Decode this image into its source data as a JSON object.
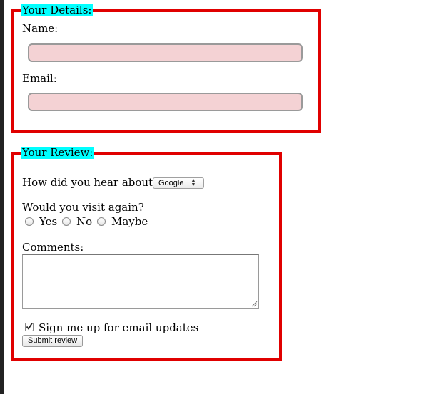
{
  "details": {
    "legend": "Your Details:",
    "name_label": "Name:",
    "name_value": "",
    "email_label": "Email:",
    "email_value": ""
  },
  "review": {
    "legend": "Your Review:",
    "heard_label": "How did you hear about us?",
    "heard_selected": "Google",
    "visit_label": "Would you visit again?",
    "visit_options": [
      "Yes",
      "No",
      "Maybe"
    ],
    "comments_label": "Comments:",
    "comments_value": "",
    "email_updates_label": "Sign me up for email updates",
    "email_updates_checked": true,
    "submit_label": "Submit review"
  },
  "colors": {
    "border": "#e00000",
    "legend_bg": "#00ffff",
    "input_bg": "#f4d2d4"
  }
}
